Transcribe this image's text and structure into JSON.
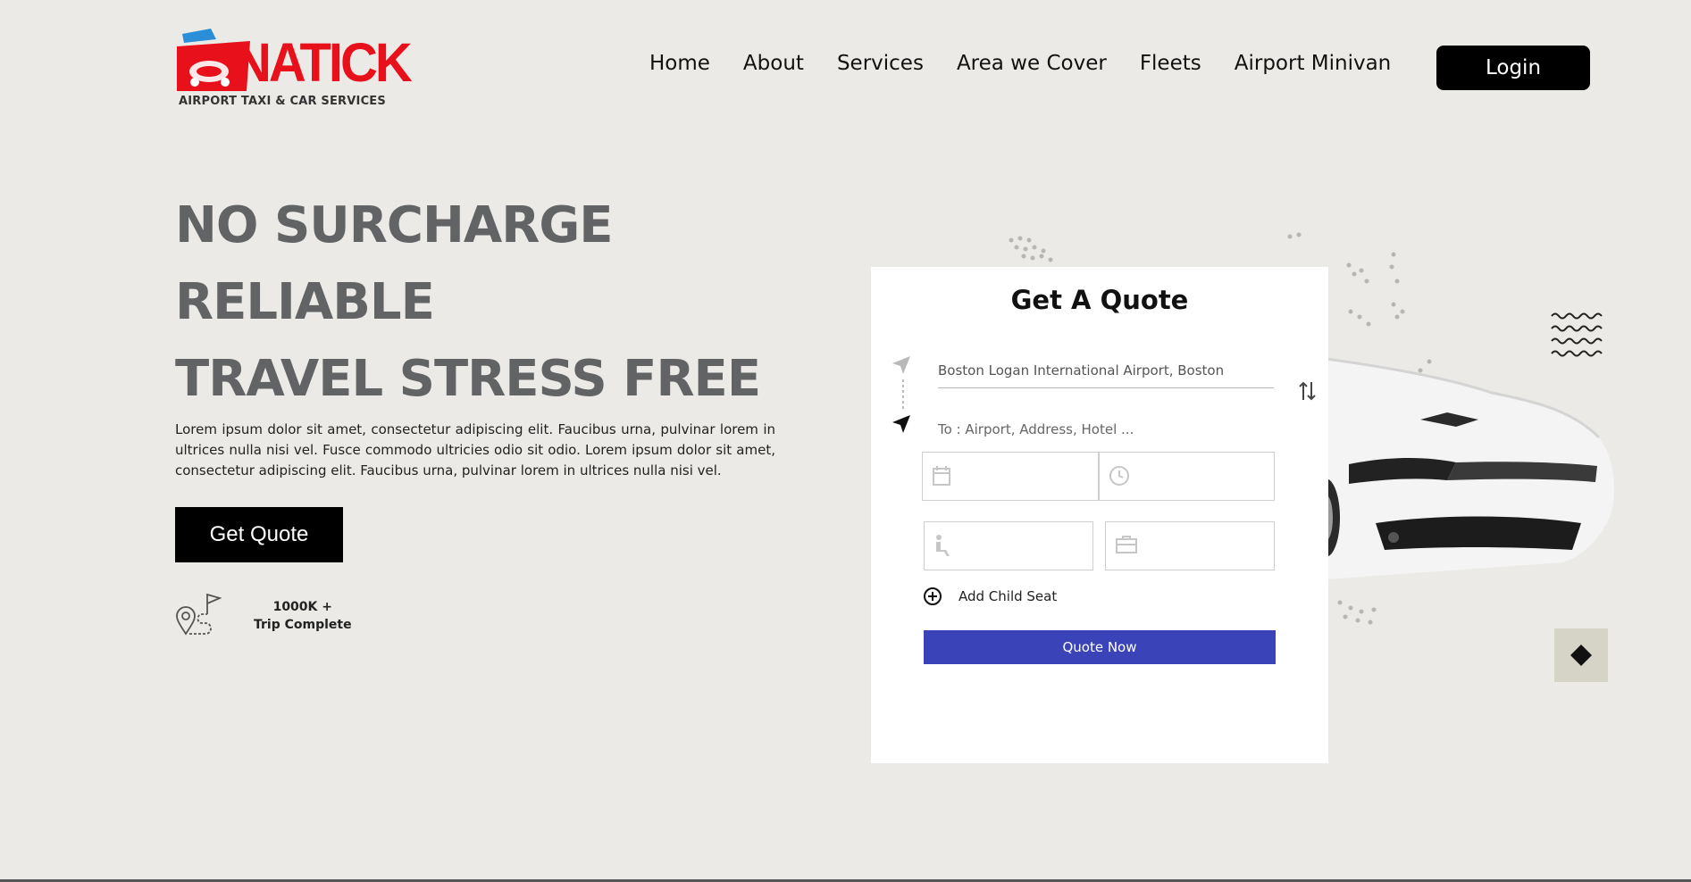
{
  "brand": {
    "name": "NATICK",
    "tagline": "AIRPORT TAXI & CAR SERVICES",
    "red": "#e8101a",
    "blue": "#2a8ed8"
  },
  "nav": {
    "items": [
      "Home",
      "About",
      "Services",
      "Area we Cover",
      "Fleets",
      "Airport Minivan"
    ],
    "login_label": "Login"
  },
  "hero": {
    "lines": [
      "NO SURCHARGE",
      "RELIABLE",
      "TRAVEL STRESS FREE"
    ],
    "paragraph": "Lorem ipsum dolor sit amet, consectetur adipiscing elit. Faucibus urna, pulvinar lorem in ultrices nulla nisi vel. Fusce commodo ultricies odio sit odio. Lorem ipsum dolor sit amet, consectetur adipiscing elit. Faucibus urna, pulvinar lorem in ultrices nulla nisi vel.",
    "cta_label": "Get Quote",
    "stat_value": "1000K +",
    "stat_label": "Trip Complete"
  },
  "quote_form": {
    "title": "Get A Quote",
    "from_value": "Boston Logan International Airport, Boston",
    "to_placeholder": "To :  Airport, Address, Hotel ...",
    "add_child_seat": "Add Child Seat",
    "submit_label": "Quote Now",
    "accent": "#3a44b8"
  },
  "icons": {
    "from": "navigation-arrow-icon",
    "to": "navigation-arrow-icon",
    "swap": "swap-vertical-icon",
    "date": "calendar-icon",
    "time": "clock-icon",
    "passengers": "seat-passenger-icon",
    "luggage": "luggage-icon",
    "add": "plus-circle-icon",
    "scroll_top": "diamond-icon"
  }
}
